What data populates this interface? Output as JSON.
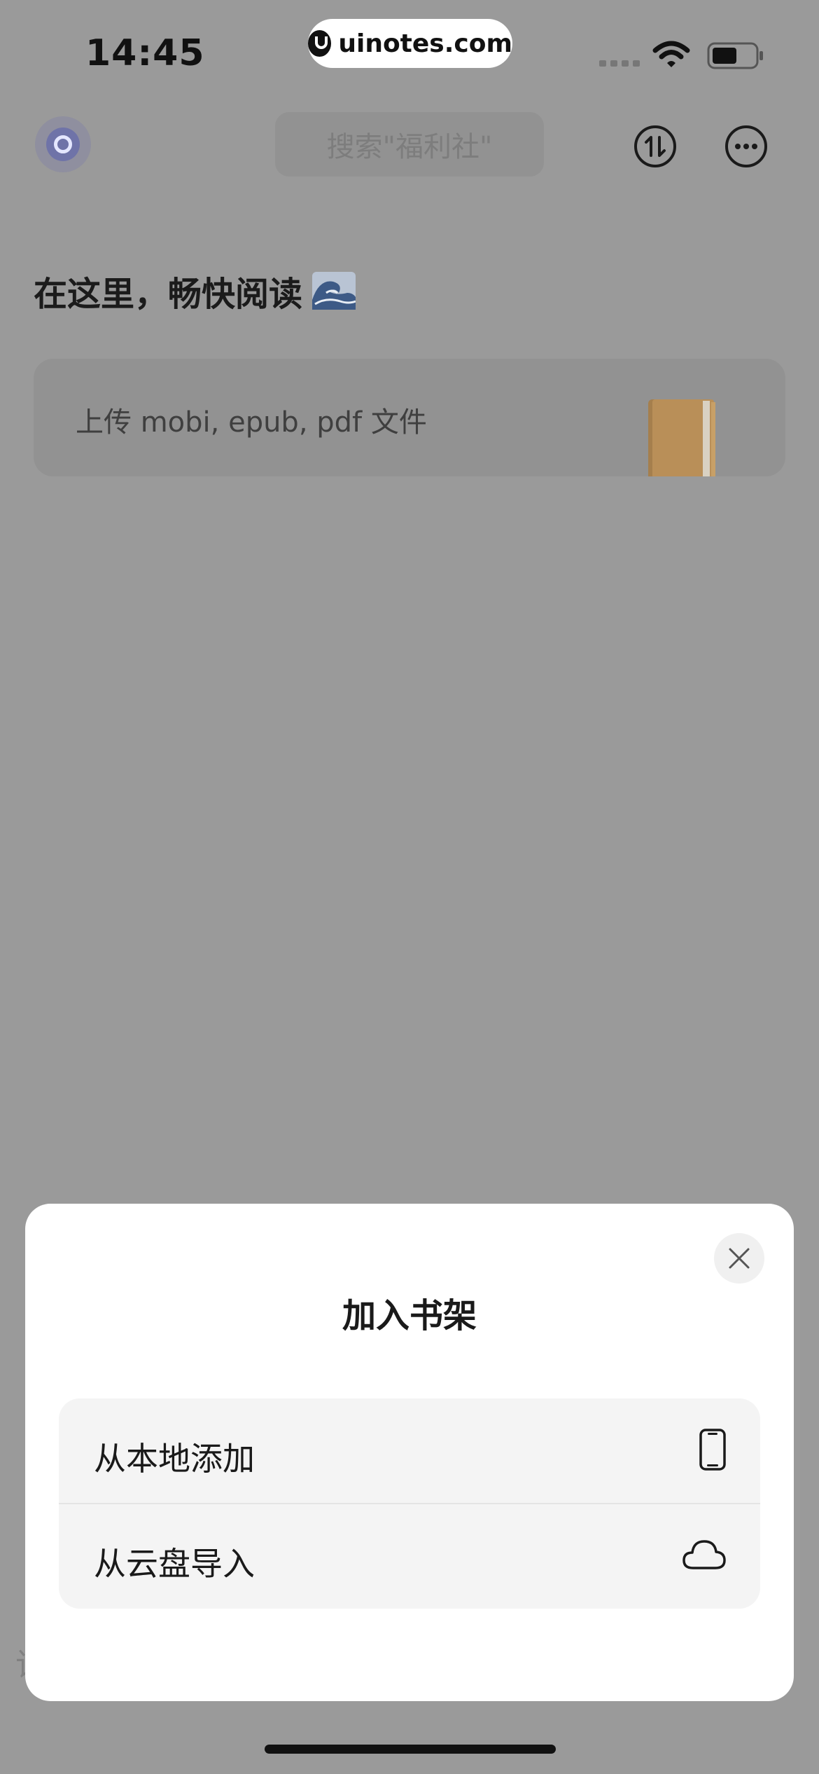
{
  "status_bar": {
    "time": "14:45",
    "watermark": "uinotes.com"
  },
  "header": {
    "search_placeholder": "搜索\"福利社\"",
    "icons": {
      "logo": "app-logo-icon",
      "sort": "sort-arrows-icon",
      "more": "more-dots-icon"
    }
  },
  "main": {
    "greeting": "在这里，畅快阅读",
    "greeting_emoji": "wave-icon",
    "upload_card": {
      "label": "上传 mobi, epub, pdf 文件",
      "icon": "book-icon"
    },
    "peek_char": "该"
  },
  "sheet": {
    "title": "加入书架",
    "options": [
      {
        "label": "从本地添加",
        "icon": "phone-icon"
      },
      {
        "label": "从云盘导入",
        "icon": "cloud-icon"
      }
    ]
  },
  "colors": {
    "overlay_bg": "#9a9a9a",
    "sheet_bg": "#ffffff",
    "options_bg": "#f4f4f4"
  }
}
